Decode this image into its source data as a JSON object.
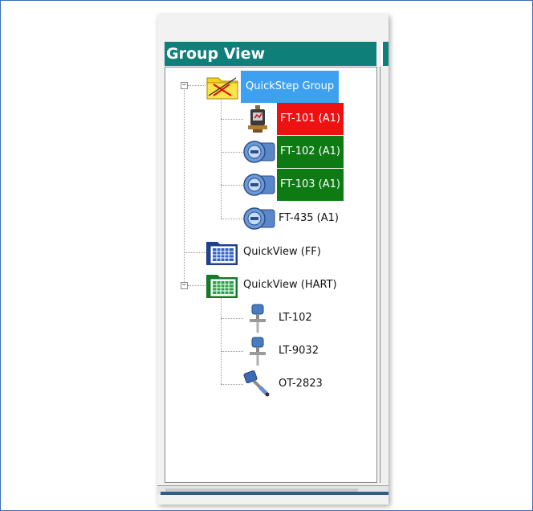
{
  "panel": {
    "title": "Group View"
  },
  "tree": {
    "root": {
      "label": "QuickStep Group",
      "icon": "folder-disabled-icon",
      "expanded": true,
      "children": [
        {
          "label": "FT-101 (A1)",
          "icon": "pressure-transmitter-icon",
          "status_color": "#ee1111"
        },
        {
          "label": "FT-102 (A1)",
          "icon": "flow-transmitter-icon",
          "status_color": "#0d7a14"
        },
        {
          "label": "FT-103 (A1)",
          "icon": "flow-transmitter-icon",
          "status_color": "#0d7a14"
        },
        {
          "label": "FT-435 (A1)",
          "icon": "flow-transmitter-icon",
          "status_color": ""
        }
      ]
    },
    "quickview_ff": {
      "label": "QuickView (FF)",
      "icon": "quickview-folder-blue-icon"
    },
    "quickview_hart": {
      "label": "QuickView (HART)",
      "icon": "quickview-folder-green-icon",
      "expanded": true,
      "children": [
        {
          "label": "LT-102",
          "icon": "level-transmitter-icon"
        },
        {
          "label": "LT-9032",
          "icon": "level-transmitter-icon"
        },
        {
          "label": "OT-2823",
          "icon": "analyzer-probe-icon"
        }
      ]
    }
  },
  "colors": {
    "header_bg": "#0f7f7a",
    "selected_bg": "#3ea0f0",
    "alarm_red": "#ee1111",
    "ok_green": "#0d7a14"
  }
}
